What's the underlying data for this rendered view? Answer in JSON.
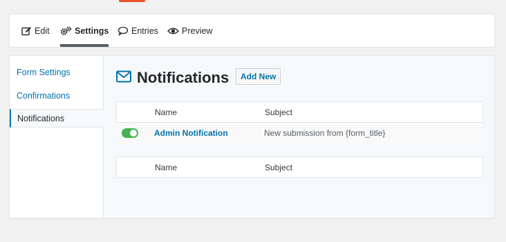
{
  "tabs": [
    {
      "label": "Edit",
      "icon": "edit-icon"
    },
    {
      "label": "Settings",
      "icon": "gears-icon",
      "active": true
    },
    {
      "label": "Entries",
      "icon": "comment-icon"
    },
    {
      "label": "Preview",
      "icon": "eye-icon"
    }
  ],
  "sidebar": {
    "items": [
      {
        "label": "Form Settings"
      },
      {
        "label": "Confirmations"
      },
      {
        "label": "Notifications",
        "active": true
      }
    ]
  },
  "main": {
    "title": "Notifications",
    "title_icon": "envelope-icon",
    "add_new_label": "Add New",
    "table": {
      "columns": [
        "Name",
        "Subject"
      ],
      "rows": [
        {
          "enabled": true,
          "name": "Admin Notification",
          "subject": "New submission from {form_title}"
        }
      ],
      "footer_columns": [
        "Name",
        "Subject"
      ]
    }
  },
  "colors": {
    "accent": "#0073aa",
    "toggle_on": "#46b450",
    "top_accent": "#e9542d"
  }
}
